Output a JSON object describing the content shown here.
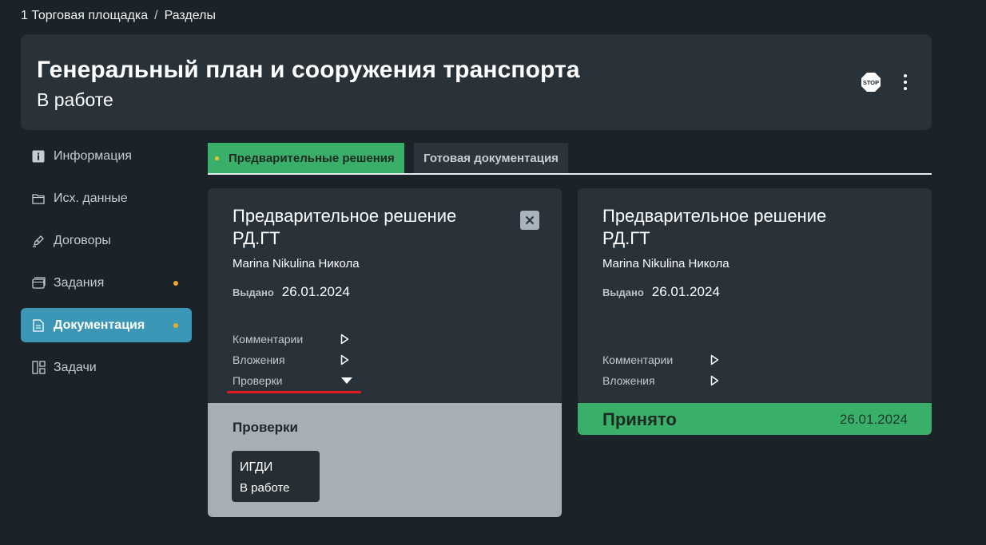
{
  "breadcrumb": {
    "item1": "1 Торговая площадка",
    "sep": "/",
    "item2": "Разделы"
  },
  "header": {
    "title": "Генеральный план и сооружения транспорта",
    "status": "В работе",
    "stop_label": "STOP"
  },
  "sidebar": {
    "items": [
      {
        "label": "Информация",
        "icon": "info-icon"
      },
      {
        "label": "Исх. данные",
        "icon": "folder-icon"
      },
      {
        "label": "Договоры",
        "icon": "pen-icon"
      },
      {
        "label": "Задания",
        "icon": "cards-icon"
      },
      {
        "label": "Документация",
        "icon": "document-icon"
      },
      {
        "label": "Задачи",
        "icon": "board-icon"
      }
    ]
  },
  "tabs": {
    "preliminary": "Предварительные решения",
    "ready": "Готовая документация"
  },
  "cards": [
    {
      "title": "Предварительное решение РД.ГТ",
      "author": "Marina Nikulina Никола",
      "issued_label": "Выдано",
      "issued_date": "26.01.2024",
      "comments": "Комментарии",
      "attachments": "Вложения",
      "checks": "Проверки"
    },
    {
      "title": "Предварительное решение РД.ГТ",
      "author": "Marina Nikulina Никола",
      "issued_label": "Выдано",
      "issued_date": "26.01.2024",
      "comments": "Комментарии",
      "attachments": "Вложения",
      "accepted_label": "Принято",
      "accepted_date": "26.01.2024"
    }
  ],
  "checks_panel": {
    "title": "Проверки",
    "items": [
      {
        "name": "ИГДИ",
        "status": "В работе"
      }
    ]
  },
  "colors": {
    "background": "#1c2328",
    "panel": "#293239",
    "active": "#3b97b5",
    "success": "#3aaf6a",
    "notice": "#f0a52d",
    "highlight": "#e11b22"
  }
}
